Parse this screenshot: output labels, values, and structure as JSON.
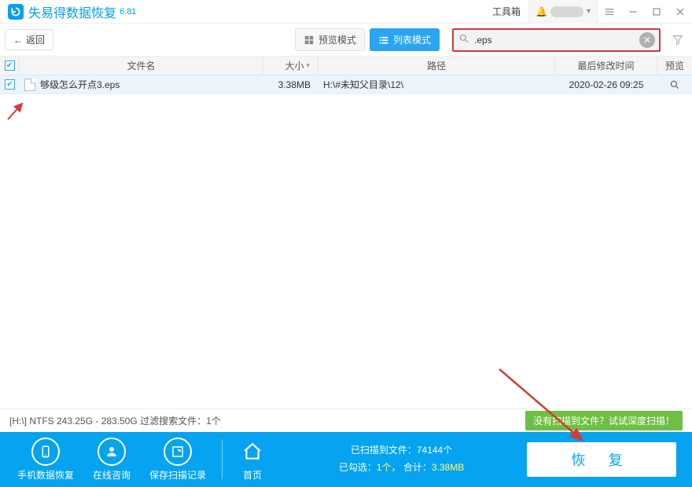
{
  "app": {
    "title": "失易得数据恢复",
    "version": "6.81"
  },
  "titlebar": {
    "toolbox": "工具箱"
  },
  "toolbar": {
    "back": "返回",
    "preview_mode": "预览模式",
    "list_mode": "列表模式",
    "search_value": ".eps"
  },
  "columns": {
    "name": "文件名",
    "size": "大小",
    "path": "路径",
    "date": "最后修改时间",
    "preview": "预览"
  },
  "row": {
    "name": "够级怎么开点3.eps",
    "size": "3.38MB",
    "path": "H:\\#未知父目录\\12\\",
    "date": "2020-02-26  09:25"
  },
  "status": {
    "disk": "[H:\\] NTFS 243.25G - 283.50G 过滤搜索文件：1个",
    "deep": "没有扫描到文件？试试深度扫描！"
  },
  "footer": {
    "phone": "手机数据恢复",
    "online": "在线咨询",
    "save": "保存扫描记录",
    "home": "首页",
    "scanned_label": "已扫描到文件：",
    "scanned_count": "74144个",
    "selected_label": "已勾选：",
    "selected_count": "1个，",
    "total_label": "合计：",
    "total_size": "3.38MB",
    "recover": "恢 复"
  }
}
